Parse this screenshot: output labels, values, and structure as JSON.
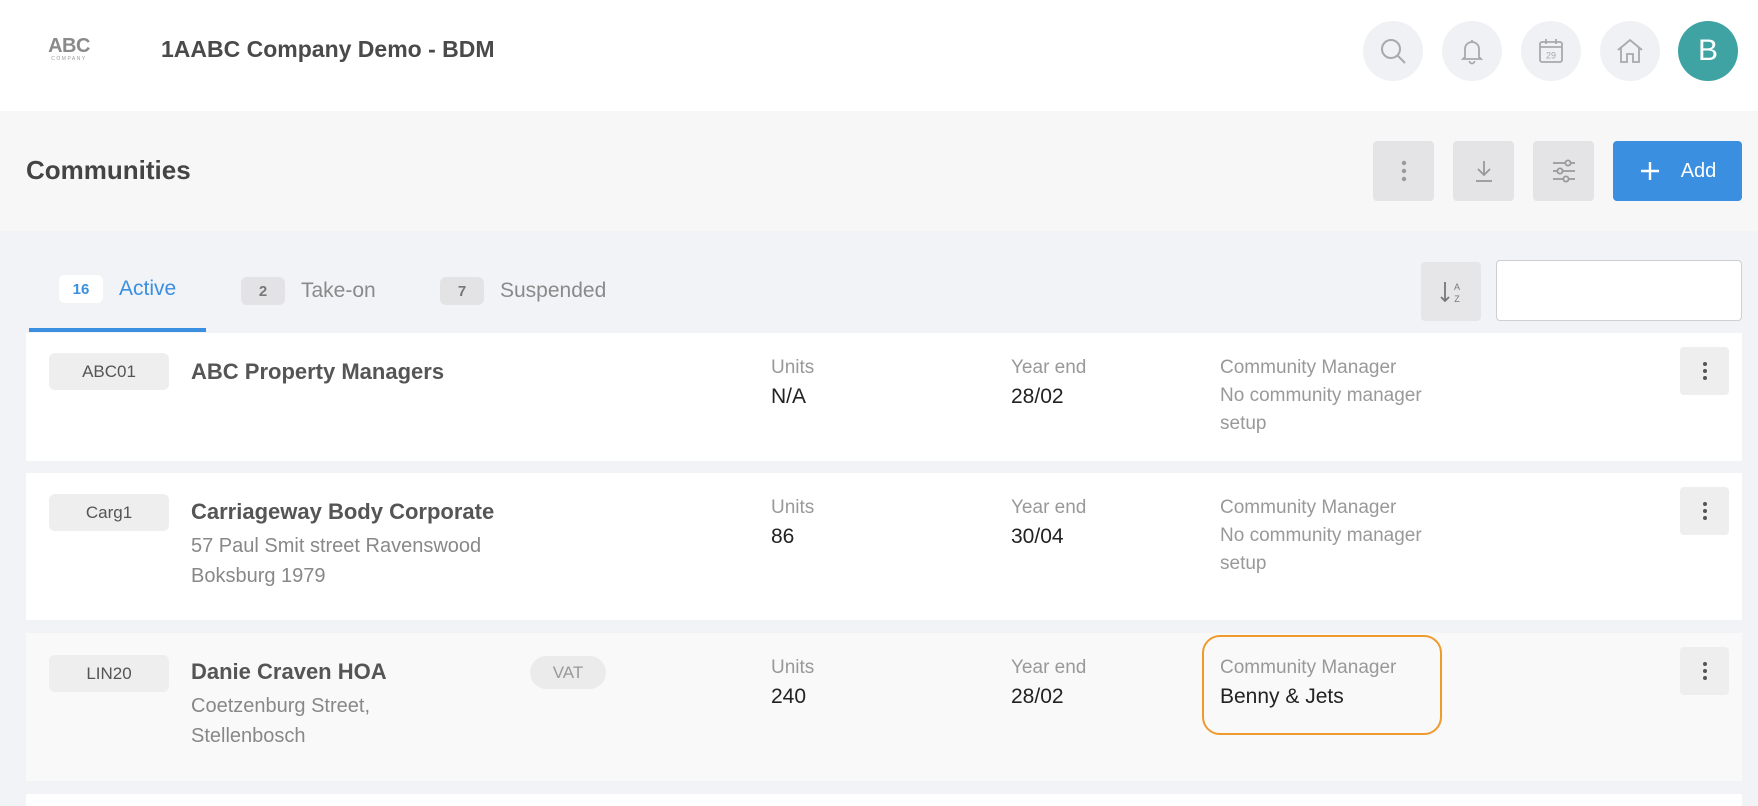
{
  "topbar": {
    "logo_text": "ABC",
    "logo_subtext": "COMPANY",
    "app_title": "1AABC Company Demo - BDM",
    "icons": [
      "search-icon",
      "bell-icon",
      "calendar-icon",
      "home-icon"
    ],
    "calendar_day": "29",
    "avatar_initial": "B"
  },
  "header": {
    "title": "Communities",
    "buttons": [
      "more-vertical-icon",
      "download-icon",
      "sliders-icon"
    ],
    "add_label": "Add"
  },
  "tabs": [
    {
      "count": "16",
      "label": "Active",
      "active": true
    },
    {
      "count": "2",
      "label": "Take-on",
      "active": false
    },
    {
      "count": "7",
      "label": "Suspended",
      "active": false
    }
  ],
  "search": {
    "value": "",
    "placeholder": ""
  },
  "labels": {
    "units": "Units",
    "year_end": "Year end",
    "community_manager": "Community Manager"
  },
  "communities": [
    {
      "code": "ABC01",
      "name": "ABC Property Managers",
      "address": [],
      "vat": "",
      "units": "N/A",
      "year_end": "28/02",
      "community_manager": "No community manager setup",
      "manager_set": false
    },
    {
      "code": "Carg1",
      "name": "Carriageway Body Corporate",
      "address": [
        "57 Paul Smit street Ravenswood",
        "Boksburg 1979"
      ],
      "vat": "",
      "units": "86",
      "year_end": "30/04",
      "community_manager": "No community manager setup",
      "manager_set": false
    },
    {
      "code": "LIN20",
      "name": "Danie Craven HOA",
      "address": [
        "Coetzenburg Street,",
        "Stellenbosch"
      ],
      "vat": "VAT",
      "units": "240",
      "year_end": "28/02",
      "community_manager": "Benny & Jets",
      "manager_set": true
    }
  ],
  "colors": {
    "accent": "#3a8fe0",
    "avatar": "#3fa3a3",
    "highlight_outline": "#ef9a2c"
  }
}
